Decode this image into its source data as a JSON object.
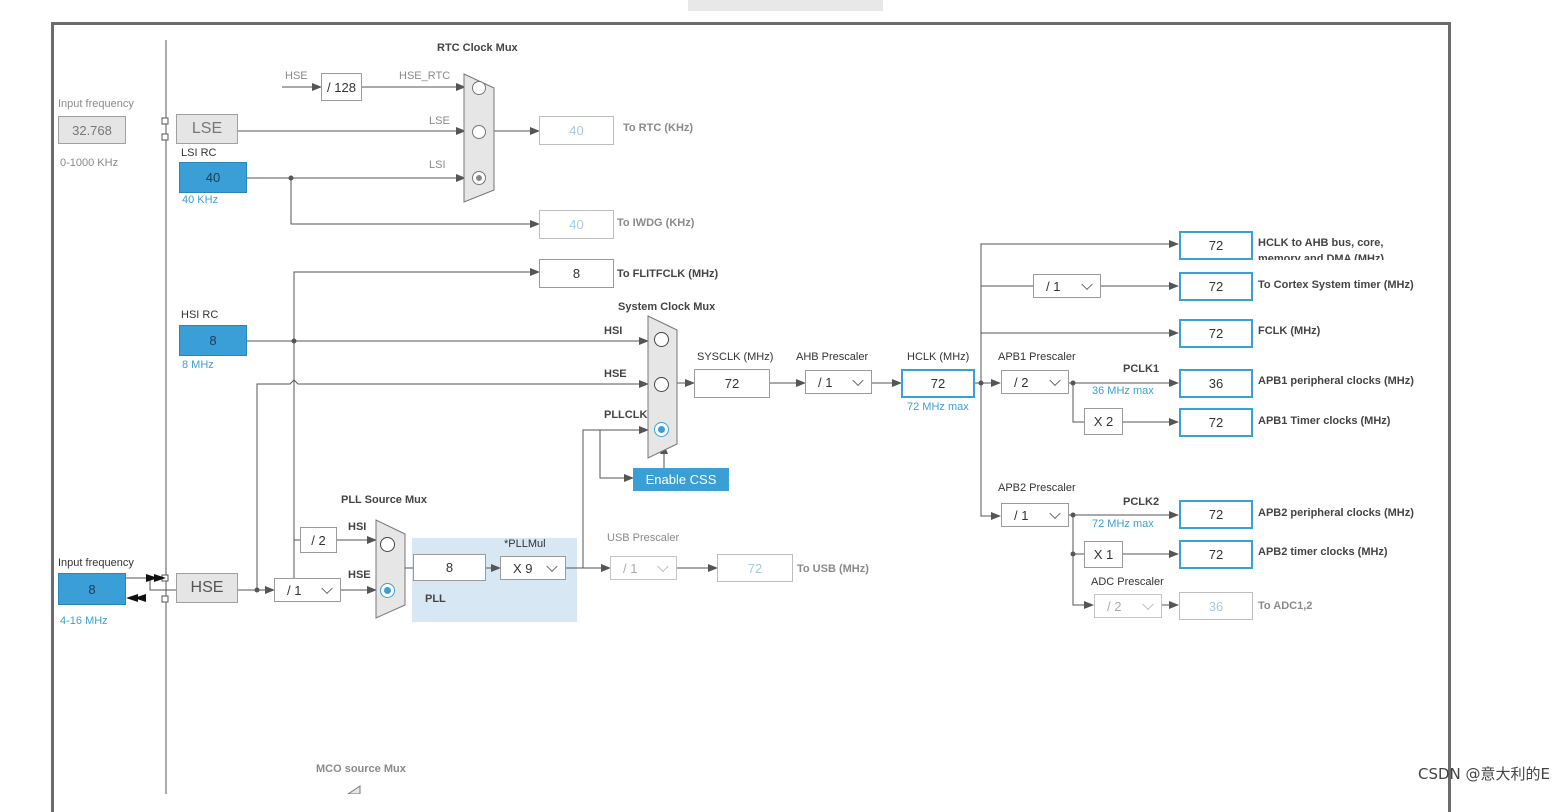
{
  "watermark": "CSDN @意大利的E",
  "inputs": {
    "lse": {
      "label": "Input frequency",
      "value": "32.768",
      "range": "0-1000 KHz",
      "block": "LSE"
    },
    "lsi": {
      "label": "LSI RC",
      "value": "40",
      "unit": "40 KHz"
    },
    "hsi": {
      "label": "HSI RC",
      "value": "8",
      "unit": "8 MHz"
    },
    "hse": {
      "label": "Input frequency",
      "value": "8",
      "range": "4-16 MHz",
      "block": "HSE"
    }
  },
  "rtc": {
    "mux_title": "RTC Clock Mux",
    "div_label": "/ 128",
    "src_labels": {
      "hse": "HSE",
      "hse_rtc": "HSE_RTC",
      "lse": "LSE",
      "lsi": "LSI"
    },
    "to_rtc": {
      "value": "40",
      "label": "To RTC (KHz)"
    },
    "to_iwdg": {
      "value": "40",
      "label": "To IWDG (KHz)"
    },
    "selected": "LSI"
  },
  "flitf": {
    "value": "8",
    "label": "To FLITFCLK (MHz)"
  },
  "sysmux": {
    "title": "System Clock Mux",
    "inputs": [
      "HSI",
      "HSE",
      "PLLCLK"
    ],
    "selected": "PLLCLK",
    "css_button": "Enable CSS"
  },
  "sysclk": {
    "label": "SYSCLK (MHz)",
    "value": "72"
  },
  "ahb": {
    "label": "AHB Prescaler",
    "value": "/ 1"
  },
  "hclk": {
    "label": "HCLK (MHz)",
    "value": "72",
    "max": "72 MHz max"
  },
  "apb1": {
    "label": "APB1 Prescaler",
    "value": "/ 2",
    "pclk": "PCLK1",
    "max": "36 MHz max",
    "mult": "X 2"
  },
  "apb2": {
    "label": "APB2 Prescaler",
    "value": "/ 1",
    "pclk": "PCLK2",
    "max": "72 MHz max",
    "mult": "X 1"
  },
  "adc": {
    "label": "ADC Prescaler",
    "value": "/ 2",
    "out": "36",
    "out_label": "To ADC1,2"
  },
  "cortex_div": "/ 1",
  "outputs": [
    {
      "value": "72",
      "label": "HCLK to AHB bus, core, memory and DMA (MHz)"
    },
    {
      "value": "72",
      "label": "To Cortex System timer (MHz)"
    },
    {
      "value": "72",
      "label": "FCLK (MHz)"
    },
    {
      "value": "36",
      "label": "APB1 peripheral clocks (MHz)"
    },
    {
      "value": "72",
      "label": "APB1 Timer clocks (MHz)"
    },
    {
      "value": "72",
      "label": "APB2 peripheral clocks (MHz)"
    },
    {
      "value": "72",
      "label": "APB2 timer clocks (MHz)"
    }
  ],
  "pll": {
    "src_title": "PLL Source Mux",
    "src_inputs": [
      "HSI",
      "HSE"
    ],
    "selected": "HSE",
    "hsi_div": "/ 2",
    "hse_div": "/ 1",
    "value": "8",
    "mul_label": "*PLLMul",
    "mul_value": "X 9",
    "block_label": "PLL"
  },
  "usb": {
    "label": "USB Prescaler",
    "value": "/ 1",
    "out": "72",
    "out_label": "To USB (MHz)"
  },
  "mco": {
    "label": "MCO source Mux"
  },
  "colors": {
    "accent": "#3a9fd6",
    "line": "#555555",
    "disabled": "#a9c8de"
  }
}
